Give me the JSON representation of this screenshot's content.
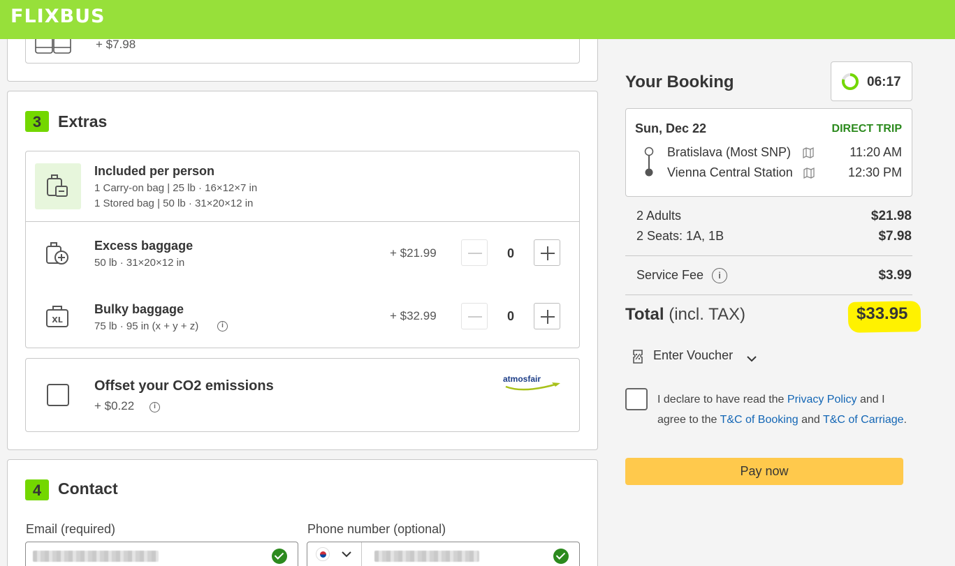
{
  "header": {
    "logo": "FLIXBUS"
  },
  "seats_partial": {
    "price_fragment": "+ $7.98"
  },
  "extras": {
    "step": "3",
    "title": "Extras",
    "included": {
      "title": "Included per person",
      "line1": "1 Carry-on bag | 25 lb · 16×12×7 in",
      "line2": "1 Stored bag | 50 lb · 31×20×12 in"
    },
    "excess": {
      "title": "Excess baggage",
      "desc": "50 lb · 31×20×12 in",
      "price": "+ $21.99",
      "qty": "0"
    },
    "bulky": {
      "title": "Bulky baggage",
      "desc": "75 lb · 95 in (x + y + z)",
      "price": "+ $32.99",
      "qty": "0"
    },
    "co2": {
      "title": "Offset your CO2 emissions",
      "price": "+ $0.22",
      "partner": "atmosfair"
    }
  },
  "contact": {
    "step": "4",
    "title": "Contact",
    "email_label": "Email (required)",
    "phone_label": "Phone number (optional)"
  },
  "booking": {
    "title": "Your Booking",
    "timer": "06:17",
    "date": "Sun, Dec 22",
    "trip_type": "DIRECT TRIP",
    "from_station": "Bratislava (Most SNP)",
    "from_time": "11:20 AM",
    "to_station": "Vienna Central Station",
    "to_time": "12:30 PM",
    "adults_label": "2 Adults",
    "adults_price": "$21.98",
    "seats_label": "2 Seats: 1A, 1B",
    "seats_price": "$7.98",
    "fee_label": "Service Fee",
    "fee_price": "$3.99",
    "total_label": "Total",
    "total_sub": "(incl. TAX)",
    "total_price": "$33.95",
    "voucher": "Enter Voucher",
    "declare_1": "I declare to have read the",
    "privacy": "Privacy Policy",
    "declare_2": "and I agree to the",
    "tc_booking": "T&C of Booking",
    "declare_3": "and",
    "tc_carriage": "T&C of Carriage",
    "pay": "Pay now"
  },
  "colors": {
    "brand": "#97e03a",
    "accent": "#73d700",
    "link": "#1366b5",
    "pay": "#ffc94c",
    "highlight": "#fff200"
  }
}
